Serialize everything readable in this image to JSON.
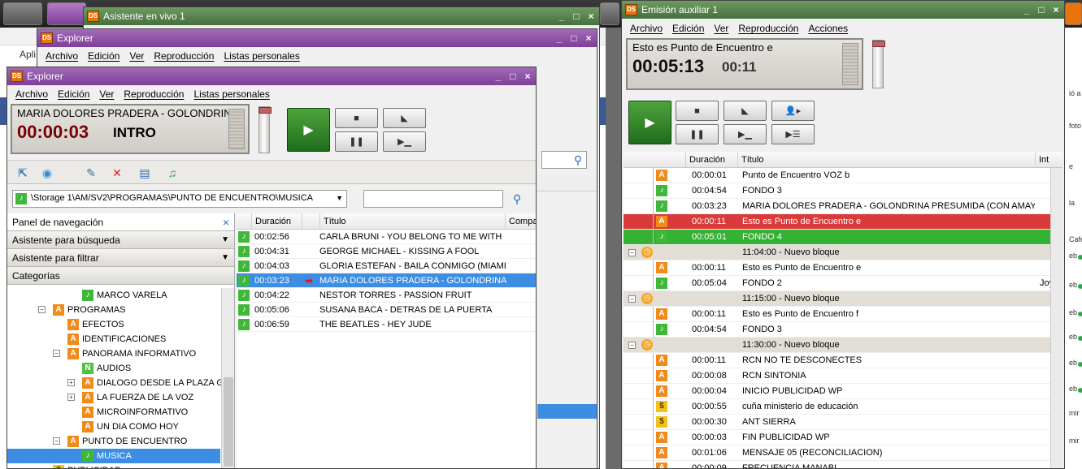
{
  "background": {
    "apps_label": "Apli",
    "right_edge_texts": [
      "ió a",
      "foto",
      "e",
      "la",
      "Café",
      "eb",
      "eb",
      "eb",
      "eb",
      "eb",
      "eb",
      "mir",
      "mir"
    ]
  },
  "asistente_window": {
    "title": "Asistente en vivo 1"
  },
  "explorer_back": {
    "title": "Explorer",
    "menu": [
      "Archivo",
      "Edición",
      "Ver",
      "Reproducción",
      "Listas personales"
    ]
  },
  "explorer": {
    "title": "Explorer",
    "menu": [
      "Archivo",
      "Edición",
      "Ver",
      "Reproducción",
      "Listas personales"
    ],
    "display": {
      "track_title": "MARIA DOLORES PRADERA - GOLONDRINA",
      "time": "00:00:03",
      "segment": "INTRO"
    },
    "path": "\\Storage 1\\AM/SV2\\PROGRAMAS\\PUNTO DE ENCUENTRO\\MUSICA",
    "nav": {
      "panel_title": "Panel de navegación",
      "close_glyph": "×",
      "search_assistant": "Asistente para búsqueda",
      "filter_assistant": "Asistente para filtrar",
      "categories": "Categorías"
    },
    "tree": [
      {
        "icon": "music",
        "label": "MARCO VARELA",
        "indent": 92,
        "expander": ""
      },
      {
        "icon": "A",
        "label": "PROGRAMAS",
        "indent": 56,
        "expander": "−"
      },
      {
        "icon": "A",
        "label": "EFECTOS",
        "indent": 74,
        "expander": ""
      },
      {
        "icon": "A",
        "label": "IDENTIFICACIONES",
        "indent": 74,
        "expander": ""
      },
      {
        "icon": "A",
        "label": "PANORAMA INFORMATIVO",
        "indent": 74,
        "expander": "−"
      },
      {
        "icon": "N",
        "label": "AUDIOS",
        "indent": 92,
        "expander": ""
      },
      {
        "icon": "A",
        "label": "DIALOGO DESDE LA PLAZA GRA",
        "indent": 92,
        "expander": "+"
      },
      {
        "icon": "A",
        "label": "LA FUERZA DE LA VOZ",
        "indent": 92,
        "expander": "+"
      },
      {
        "icon": "A",
        "label": "MICROINFORMATIVO",
        "indent": 92,
        "expander": ""
      },
      {
        "icon": "A",
        "label": "UN DIA COMO HOY",
        "indent": 92,
        "expander": ""
      },
      {
        "icon": "A",
        "label": "PUNTO DE ENCUENTRO",
        "indent": 74,
        "expander": "−"
      },
      {
        "icon": "music",
        "label": "MUSICA",
        "indent": 92,
        "expander": "",
        "selected": true
      },
      {
        "icon": "S",
        "label": "PUBLICIDAD",
        "indent": 56,
        "expander": ""
      }
    ],
    "columns": [
      "Duración",
      "Título",
      "Compa"
    ],
    "rows": [
      {
        "duration": "00:02:56",
        "title": "CARLA BRUNI - YOU BELONG TO ME WITH",
        "selected": false
      },
      {
        "duration": "00:04:31",
        "title": "GEORGE MICHAEL - KISSING A FOOL",
        "selected": false
      },
      {
        "duration": "00:04:03",
        "title": "GLORIA ESTEFAN - BAILA CONMIGO (MIAMI ...",
        "selected": false
      },
      {
        "duration": "00:03:23",
        "title": "MARIA DOLORES PRADERA - GOLONDRINA ...",
        "selected": true
      },
      {
        "duration": "00:04:22",
        "title": "NESTOR TORRES - PASSION FRUIT",
        "selected": false
      },
      {
        "duration": "00:05:06",
        "title": "SUSANA BACA - DETRAS DE LA PUERTA",
        "selected": false
      },
      {
        "duration": "00:06:59",
        "title": "THE BEATLES - HEY JUDE",
        "selected": false
      }
    ]
  },
  "emision": {
    "title": "Emisión auxiliar 1",
    "menu": [
      "Archivo",
      "Edición",
      "Ver",
      "Reproducción",
      "Acciones"
    ],
    "display": {
      "track_title": "Esto es Punto de Encuentro e",
      "time": "00:05:13",
      "remaining": "00:11"
    },
    "columns": [
      "Duración",
      "Título",
      "Int"
    ],
    "rows": [
      {
        "icon": "A",
        "duration": "00:00:01",
        "title": "Punto de Encuentro VOZ b",
        "extra": "",
        "style": ""
      },
      {
        "icon": "music",
        "duration": "00:04:54",
        "title": "FONDO 3",
        "extra": "",
        "style": ""
      },
      {
        "icon": "music",
        "duration": "00:03:23",
        "title": "MARIA DOLORES PRADERA - GOLONDRINA PRESUMIDA  (CON AMAYA ...",
        "extra": "",
        "style": ""
      },
      {
        "icon": "A",
        "duration": "00:00:11",
        "title": "Esto es Punto de Encuentro e",
        "extra": "",
        "style": "red"
      },
      {
        "icon": "music",
        "duration": "00:05:01",
        "title": "FONDO 4",
        "extra": "",
        "style": "green"
      },
      {
        "icon": "clock",
        "duration": "",
        "title": "11:04:00 - Nuevo bloque",
        "extra": "",
        "style": "block"
      },
      {
        "icon": "A",
        "duration": "00:00:11",
        "title": "Esto es Punto de Encuentro e",
        "extra": "",
        "style": ""
      },
      {
        "icon": "music",
        "duration": "00:05:04",
        "title": "FONDO 2",
        "extra": "Joy",
        "style": ""
      },
      {
        "icon": "clock",
        "duration": "",
        "title": "11:15:00 - Nuevo bloque",
        "extra": "",
        "style": "block"
      },
      {
        "icon": "A",
        "duration": "00:00:11",
        "title": "Esto es Punto de Encuentro f",
        "extra": "",
        "style": ""
      },
      {
        "icon": "music",
        "duration": "00:04:54",
        "title": "FONDO 3",
        "extra": "",
        "style": ""
      },
      {
        "icon": "clock",
        "duration": "",
        "title": "11:30:00 - Nuevo bloque",
        "extra": "",
        "style": "block"
      },
      {
        "icon": "A",
        "duration": "00:00:11",
        "title": "RCN NO TE DESCONECTES",
        "extra": "",
        "style": ""
      },
      {
        "icon": "A",
        "duration": "00:00:08",
        "title": "RCN SINTONIA",
        "extra": "",
        "style": ""
      },
      {
        "icon": "A",
        "duration": "00:00:04",
        "title": "INICIO  PUBLICIDAD WP",
        "extra": "",
        "style": ""
      },
      {
        "icon": "S",
        "duration": "00:00:55",
        "title": "cuña ministerio de educación",
        "extra": "",
        "style": ""
      },
      {
        "icon": "S",
        "duration": "00:00:30",
        "title": "ANT SIERRA",
        "extra": "",
        "style": ""
      },
      {
        "icon": "A",
        "duration": "00:00:03",
        "title": "FIN  PUBLICIDAD WP",
        "extra": "",
        "style": ""
      },
      {
        "icon": "A",
        "duration": "00:01:06",
        "title": "MENSAJE 05 (RECONCILIACION)",
        "extra": "",
        "style": ""
      },
      {
        "icon": "A",
        "duration": "00:00:09",
        "title": "FRECUENCIA  MANABI",
        "extra": "",
        "style": ""
      }
    ]
  },
  "icons": {
    "play": "▶",
    "stop": "■",
    "pause": "❚❚",
    "fade": "◣",
    "next": "▶▁",
    "search": "⚲"
  },
  "colors": {
    "purple_title": "#7e3f98",
    "green_title": "#456f3d",
    "selection": "#3d8ee2",
    "on_air_red": "#d93a3a",
    "next_green": "#34b233"
  }
}
